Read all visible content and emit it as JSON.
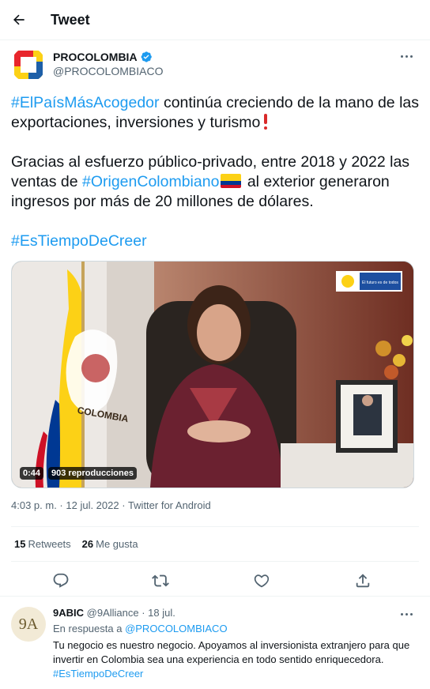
{
  "header": {
    "title": "Tweet"
  },
  "author": {
    "name": "PROCOLOMBIA",
    "handle": "@PROCOLOMBIACO"
  },
  "tweet": {
    "line1_hashtag": "#ElPaísMásAcogedor",
    "line1_text": " continúa creciendo de la mano de las exportaciones, inversiones y turismo",
    "line2_text_a": "Gracias al esfuerzo público-privado, entre 2018 y 2022 las ventas de ",
    "line2_hashtag": "#OrigenColombiano",
    "line2_text_b": " al exterior generaron ingresos por más de 20 millones de dólares.",
    "line3_hashtag": "#EsTiempoDeCreer"
  },
  "media": {
    "duration": "0:44",
    "views": "903 reproducciones",
    "flag_banner_text": "COLOMBIA",
    "badge_text": "El futuro es de todos"
  },
  "meta": {
    "time": "4:03 p. m.",
    "dot1": " · ",
    "date": "12 jul. 2022",
    "dot2": " · ",
    "source": "Twitter for Android"
  },
  "stats": {
    "retweets_count": "15",
    "retweets_label": "Retweets",
    "likes_count": "26",
    "likes_label": "Me gusta"
  },
  "reply": {
    "avatar_text": "9A",
    "name": "9ABIC",
    "handle": "@9Alliance",
    "date": "18 jul.",
    "in_reply_prefix": "En respuesta a ",
    "in_reply_to": "@PROCOLOMBIACO",
    "body": "Tu negocio es nuestro negocio. Apoyamos al inversionista extranjero para que invertir en Colombia sea una experiencia en todo sentido enriquecedora.",
    "hashtag": "#EsTiempoDeCreer"
  },
  "colors": {
    "accent": "#1d9bf0",
    "text": "#0f1419",
    "secondary": "#536471",
    "flag_yellow": "#fcd116",
    "flag_blue": "#003893",
    "flag_red": "#ce1126"
  },
  "icons": {
    "back": "arrow-left-icon",
    "verified": "verified-badge-icon",
    "more": "more-dots-icon",
    "reply": "reply-icon",
    "retweet": "retweet-icon",
    "like": "heart-icon",
    "share": "share-icon"
  }
}
